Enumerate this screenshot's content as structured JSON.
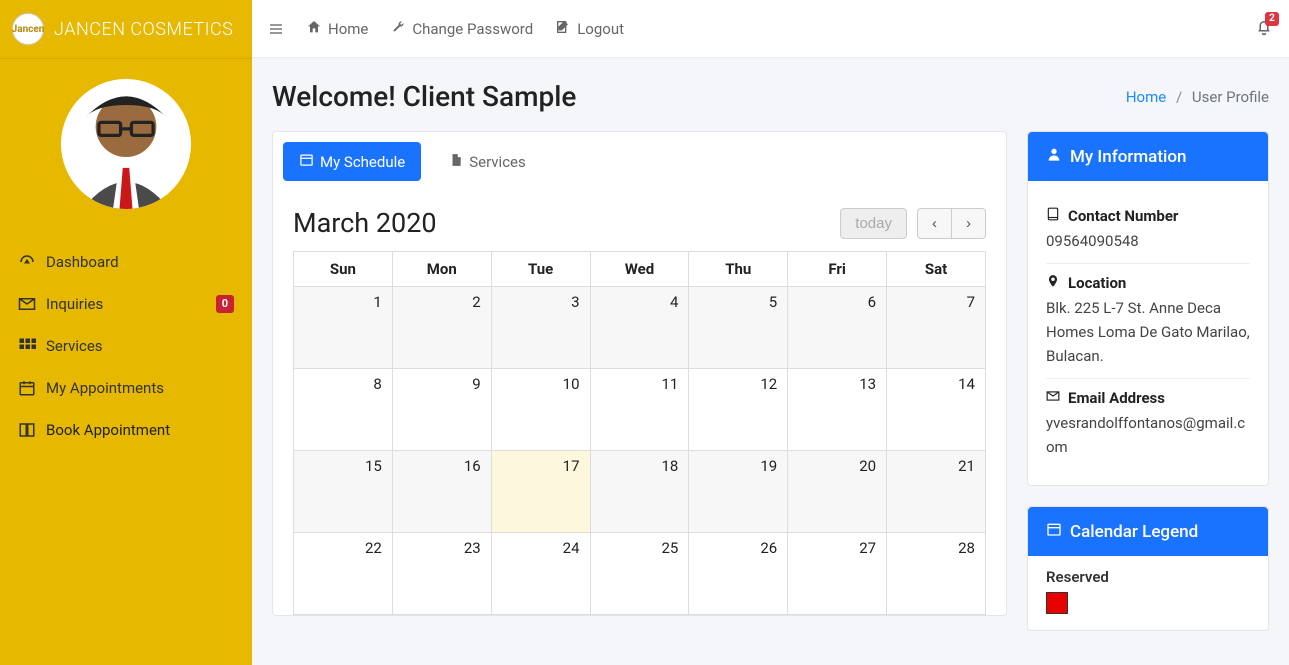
{
  "brand": {
    "name": "JANCEN COSMETICS",
    "logo_text": "Jancen"
  },
  "sidebar": {
    "items": [
      {
        "label": "Dashboard",
        "icon": "tachometer-icon"
      },
      {
        "label": "Inquiries",
        "icon": "envelope-icon",
        "badge": "0"
      },
      {
        "label": "Services",
        "icon": "grid-icon"
      },
      {
        "label": "My Appointments",
        "icon": "calendar-icon"
      },
      {
        "label": "Book Appointment",
        "icon": "book-icon"
      }
    ]
  },
  "topbar": {
    "home": "Home",
    "change_password": "Change Password",
    "logout": "Logout",
    "notif_count": "2"
  },
  "header": {
    "title": "Welcome! Client Sample",
    "crumb_home": "Home",
    "crumb_active": "User Profile"
  },
  "tabs": {
    "schedule": "My Schedule",
    "services": "Services"
  },
  "calendar": {
    "title": "March 2020",
    "today_btn": "today",
    "days": [
      "Sun",
      "Mon",
      "Tue",
      "Wed",
      "Thu",
      "Fri",
      "Sat"
    ],
    "weeks": [
      [
        "1",
        "2",
        "3",
        "4",
        "5",
        "6",
        "7"
      ],
      [
        "8",
        "9",
        "10",
        "11",
        "12",
        "13",
        "14"
      ],
      [
        "15",
        "16",
        "17",
        "18",
        "19",
        "20",
        "21"
      ],
      [
        "22",
        "23",
        "24",
        "25",
        "26",
        "27",
        "28"
      ]
    ],
    "today_cell": {
      "row": 2,
      "col": 2
    },
    "shade_rows": [
      0,
      2
    ]
  },
  "info": {
    "panel_title": "My Information",
    "contact_label": "Contact Number",
    "contact_value": "09564090548",
    "location_label": "Location",
    "location_value": "Blk. 225 L-7 St. Anne Deca Homes Loma De Gato Marilao, Bulacan.",
    "email_label": "Email Address",
    "email_value": "yvesrandolffontanos@gmail.com"
  },
  "legend": {
    "panel_title": "Calendar Legend",
    "reserved_label": "Reserved",
    "reserved_color": "#e60000"
  }
}
